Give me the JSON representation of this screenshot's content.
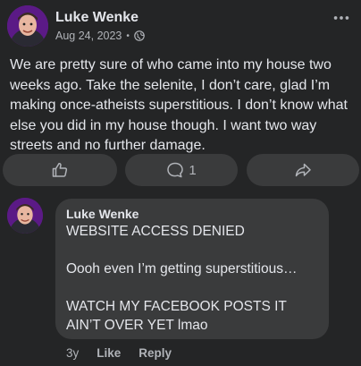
{
  "post": {
    "author": "Luke Wenke",
    "date": "Aug 24, 2023",
    "separator": "•",
    "audience_icon": "globe-icon",
    "more_icon": "more-horizontal-icon",
    "body": "We are pretty sure of who came into my house two weeks ago.  Take the selenite, I don’t care, glad I’m making once-atheists superstitious.  I don’t know what else you did in my house though.  I want two way streets and no further damage."
  },
  "actions": {
    "like_icon": "thumbs-up-icon",
    "comment_icon": "comment-icon",
    "comment_count": "1",
    "share_icon": "share-icon"
  },
  "comment": {
    "author": "Luke Wenke",
    "text": "WEBSITE ACCESS DENIED\n\nOooh even I’m getting superstitious…\n\nWATCH MY FACEBOOK POSTS IT AIN’T OVER YET lmao",
    "age": "3y",
    "like_label": "Like",
    "reply_label": "Reply"
  },
  "colors": {
    "background": "#242526",
    "bubble": "#3a3b3c",
    "text": "#e4e6eb",
    "muted": "#b0b3b8"
  }
}
